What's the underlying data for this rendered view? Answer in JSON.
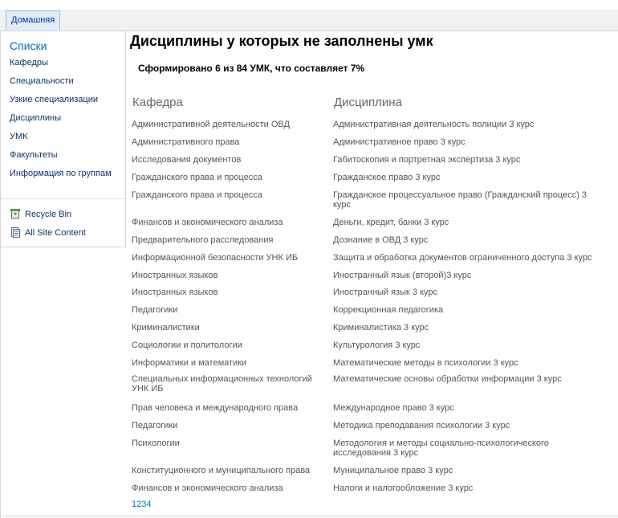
{
  "tabs": [
    {
      "label": "Домашняя"
    }
  ],
  "leftnav": {
    "heading": "Списки",
    "items": [
      {
        "label": "Кафедры"
      },
      {
        "label": "Специальности"
      },
      {
        "label": "Узкие специализации"
      },
      {
        "label": "Дисциплины"
      },
      {
        "label": "УМК"
      },
      {
        "label": "Факультеты"
      },
      {
        "label": "Информация по группам"
      }
    ],
    "recycle_bin": "Recycle Bin",
    "all_site_content": "All Site Content"
  },
  "main": {
    "title": "Дисциплины у которых не заполнены умк",
    "summary": "Сформировано 6 из 84 УМК, что составляет 7%",
    "columns": {
      "department": "Кафедра",
      "discipline": "Дисциплина"
    },
    "rows": [
      {
        "department": "Административной деятельности ОВД",
        "discipline": "Административная деятельность полиции 3 курс"
      },
      {
        "department": "Административного права",
        "discipline": "Административное право 3 курс"
      },
      {
        "department": "Исследования документов",
        "discipline": "Габитоскопия и портретная экспертиза 3 курс"
      },
      {
        "department": "Гражданского права и процесса",
        "discipline": "Гражданское право 3 курс"
      },
      {
        "department": "Гражданского права и процесса",
        "discipline": "Гражданское процессуальное право (Гражданский процесс) 3 курс"
      },
      {
        "department": "Финансов и экономического анализа",
        "discipline": "Деньги, кредит, банки 3 курс"
      },
      {
        "department": "Предварительного расследования",
        "discipline": "Дознание в ОВД 3 курс"
      },
      {
        "department": "Информационной безопасности УНК ИБ",
        "discipline": "Защита и обработка документов ограниченного доступа 3 курс"
      },
      {
        "department": "Иностранных языков",
        "discipline": "Иностранный язык (второй)3 курс"
      },
      {
        "department": "Иностранных языков",
        "discipline": "Иностранный язык 3 курс"
      },
      {
        "department": "Педагогики",
        "discipline": "Коррекционная педагогика"
      },
      {
        "department": "Криминалистики",
        "discipline": "Криминалистика 3 курс"
      },
      {
        "department": "Социологии и политологии",
        "discipline": "Культурология 3 курс"
      },
      {
        "department": "Информатики и математики",
        "discipline": "Математические методы в психологии 3 курс"
      },
      {
        "department": "Специальных информационных технологий УНК ИБ",
        "discipline": "Математические основы обработки информации 3 курс"
      },
      {
        "department": "Прав человека и международного права",
        "discipline": "Международное право 3 курс"
      },
      {
        "department": "Педагогики",
        "discipline": "Методика преподавания психологии 3 курс"
      },
      {
        "department": "Психологии",
        "discipline": "Методология и методы социально-психологического исследования 3 курс"
      },
      {
        "department": "Конституционного и муниципального права",
        "discipline": "Муниципальное право 3 курс"
      },
      {
        "department": "Финансов и экономического анализа",
        "discipline": "Налоги и налогообложение 3 курс"
      }
    ],
    "pager": [
      "1",
      "2",
      "3",
      "4"
    ]
  }
}
